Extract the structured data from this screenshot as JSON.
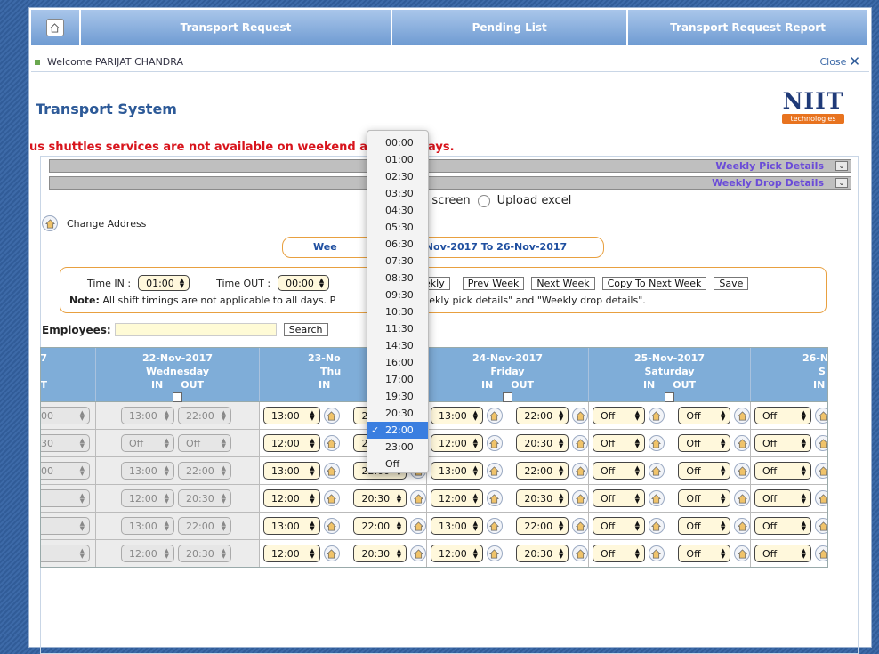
{
  "nav": {
    "tabs": [
      "Transport Request",
      "Pending List",
      "Transport Request Report"
    ]
  },
  "welcome": {
    "text": "Welcome PARIJAT CHANDRA",
    "close_label": "Close"
  },
  "title": "Transport System",
  "logo": {
    "word": "NIIT",
    "tag": "technologies"
  },
  "notice": {
    "left_text": "us shuttles services are not available on weekend a",
    "right_text": "Holidays."
  },
  "panels": {
    "pick": "Weekly Pick Details",
    "drop": "Weekly Drop Details"
  },
  "radio": {
    "option1": "a on screen",
    "option2": "Upload excel"
  },
  "change_address": "Change Address",
  "week_label": {
    "left": "Wee",
    "right": "r 20-Nov-2017 To 26-Nov-2017"
  },
  "time_controls": {
    "time_in_label": "Time IN :",
    "time_in_value": "01:00",
    "time_out_label": "Time OUT :",
    "time_out_value": "00:00",
    "weekly_btn": "Weekly",
    "prev_btn": "Prev Week",
    "next_btn": "Next Week",
    "copy_btn": "Copy To Next Week",
    "save_btn": "Save",
    "note_label": "Note:",
    "note_text": "All shift timings are not applicable to all days. P",
    "note_text2": "o \"Weekly pick details\" and \"Weekly drop details\"."
  },
  "employees": {
    "label": "Employees:",
    "search_btn": "Search"
  },
  "table": {
    "headers": [
      {
        "date": "17",
        "day": "",
        "in": "",
        "out": "T"
      },
      {
        "date": "22-Nov-2017",
        "day": "Wednesday",
        "in": "IN",
        "out": "OUT"
      },
      {
        "date": "23-No",
        "day": "Thu",
        "in": "IN",
        "out": ""
      },
      {
        "date": "24-Nov-2017",
        "day": "Friday",
        "in": "IN",
        "out": "OUT"
      },
      {
        "date": "25-Nov-2017",
        "day": "Saturday",
        "in": "IN",
        "out": "OUT"
      },
      {
        "date": "26-N",
        "day": "S",
        "in": "IN",
        "out": ""
      }
    ],
    "rows": [
      {
        "c0": "00",
        "wed_in": "13:00",
        "wed_out": "22:00",
        "thu_in": "13:00",
        "thu_out": "22:00",
        "fri_in": "13:00",
        "fri_out": "22:00",
        "sat_in": "Off",
        "sat_out": "Off",
        "sun_in": "Off"
      },
      {
        "c0": "30",
        "wed_in": "Off",
        "wed_out": "Off",
        "thu_in": "12:00",
        "thu_out": "20:30",
        "fri_in": "12:00",
        "fri_out": "20:30",
        "sat_in": "Off",
        "sat_out": "Off",
        "sun_in": "Off"
      },
      {
        "c0": "00",
        "wed_in": "13:00",
        "wed_out": "22:00",
        "thu_in": "13:00",
        "thu_out": "22:00",
        "fri_in": "13:00",
        "fri_out": "22:00",
        "sat_in": "Off",
        "sat_out": "Off",
        "sun_in": "Off"
      },
      {
        "c0": "",
        "wed_in": "12:00",
        "wed_out": "20:30",
        "thu_in": "12:00",
        "thu_out": "20:30",
        "fri_in": "12:00",
        "fri_out": "20:30",
        "sat_in": "Off",
        "sat_out": "Off",
        "sun_in": "Off"
      },
      {
        "c0": "",
        "wed_in": "13:00",
        "wed_out": "22:00",
        "thu_in": "13:00",
        "thu_out": "22:00",
        "fri_in": "13:00",
        "fri_out": "22:00",
        "sat_in": "Off",
        "sat_out": "Off",
        "sun_in": "Off"
      },
      {
        "c0": "",
        "wed_in": "12:00",
        "wed_out": "20:30",
        "thu_in": "12:00",
        "thu_out": "20:30",
        "fri_in": "12:00",
        "fri_out": "20:30",
        "sat_in": "Off",
        "sat_out": "Off",
        "sun_in": "Off"
      }
    ]
  },
  "dropdown": {
    "options": [
      "00:00",
      "01:00",
      "02:30",
      "03:30",
      "04:30",
      "05:30",
      "06:30",
      "07:30",
      "08:30",
      "09:30",
      "10:30",
      "11:30",
      "14:30",
      "16:00",
      "17:00",
      "19:30",
      "20:30",
      "22:00",
      "23:00",
      "Off"
    ],
    "selected": "22:00"
  }
}
